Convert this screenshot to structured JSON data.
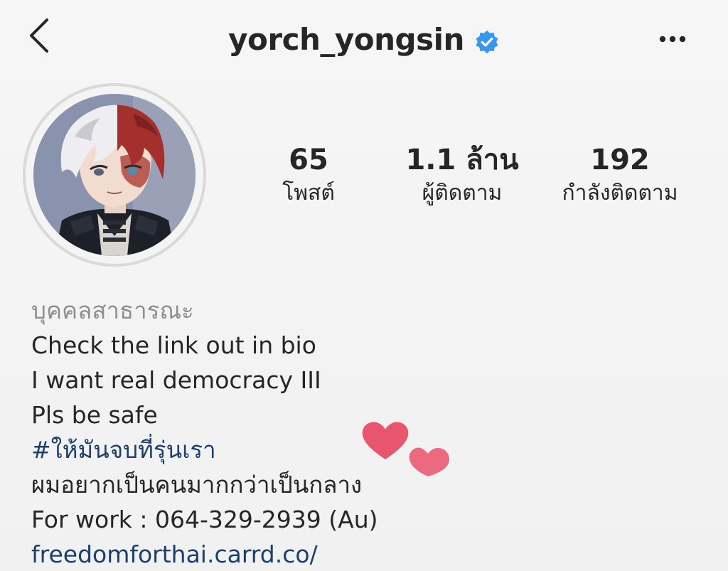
{
  "header": {
    "username": "yorch_yongsin",
    "verified_color": "#3897f0",
    "back_icon": "chevron-left-icon",
    "more_icon": "ellipsis-icon"
  },
  "stats": {
    "posts": {
      "value": "65",
      "label": "โพสต์"
    },
    "followers": {
      "value": "1.1 ล้าน",
      "label": "ผู้ติดตาม"
    },
    "following": {
      "value": "192",
      "label": "กำลังติดตาม"
    }
  },
  "bio": {
    "category": "บุคคลสาธารณะ",
    "lines": [
      "Check the link out in bio",
      "I want real democracy III",
      "Pls be safe"
    ],
    "hashtag": "#ให้มันจบที่รุ่นเรา",
    "line_thai": "ผมอยากเป็นคนมากกว่าเป็นกลาง",
    "work": "For work : 064-329-2939 (Au)",
    "link": "freedomforthai.carrd.co/"
  },
  "colors": {
    "text": "#262626",
    "muted": "#8e8e8e",
    "link": "#1c3f6e",
    "heart": "#e8566e"
  }
}
